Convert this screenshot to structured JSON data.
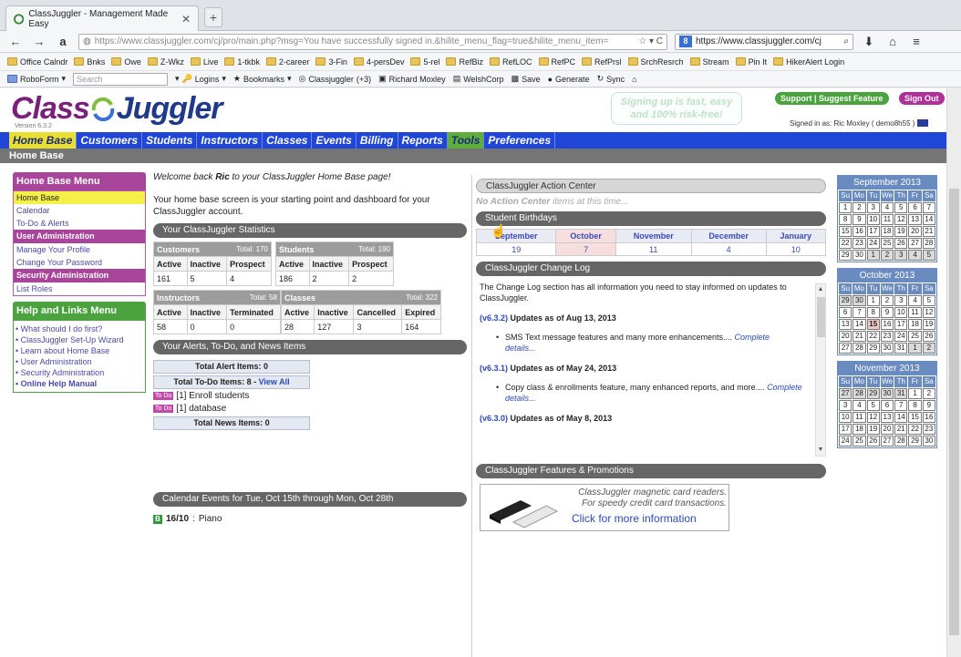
{
  "browser": {
    "tab_title": "ClassJuggler - Management Made Easy",
    "url": "https://www.classjuggler.com/cj/pro/main.php?msg=You have successfully signed in.&hilite_menu_flag=true&hilite_menu_item=",
    "search_text": "https://www.classjuggler.com/cj",
    "bookmarks": [
      "Office Calndr",
      "Bnks",
      "Owe",
      "Z-Wkz",
      "Live",
      "1-tkbk",
      "2-career",
      "3-Fin",
      "4-persDev",
      "5-rel",
      "RefBiz",
      "RefLOC",
      "RefPC",
      "RefPrsl",
      "SrchResrch",
      "Stream",
      "Pin It",
      "HikerAlert Login"
    ],
    "toolbar": {
      "roboform": "RoboForm",
      "search_placeholder": "Search",
      "logins": "Logins",
      "bookmarks": "Bookmarks",
      "classjuggler": "Classjuggler",
      "cj_count": "(+3)",
      "richard": "Richard Moxley",
      "welshcorp": "WelshCorp",
      "save": "Save",
      "generate": "Generate",
      "sync": "Sync"
    }
  },
  "header": {
    "logo_part1": "Class",
    "logo_part2": "Juggler",
    "version": "Version 6.3.2",
    "promo_line1": "Signing up is fast, easy",
    "promo_line2": "and 100% risk-free!",
    "support": "Support",
    "suggest": "Suggest Feature",
    "signout": "Sign Out",
    "signed_in": "Signed in as: Ric Moxley ( demo8h55 )"
  },
  "nav": [
    "Home Base",
    "Customers",
    "Students",
    "Instructors",
    "Classes",
    "Events",
    "Billing",
    "Reports",
    "Tools",
    "Preferences"
  ],
  "page_title": "Home Base",
  "left_menu": {
    "title": "Home Base Menu",
    "items": [
      "Home Base",
      "Calendar",
      "To-Do & Alerts"
    ],
    "user_admin_title": "User Administration",
    "user_admin_items": [
      "Manage Your Profile",
      "Change Your Password"
    ],
    "security_title": "Security Administration",
    "security_items": [
      "List Roles"
    ],
    "help_title": "Help and Links Menu",
    "help_items": [
      "What should I do first?",
      "ClassJuggler Set-Up Wizard",
      "Learn about Home Base",
      "User Administration",
      "Security Administration",
      "Online Help Manual"
    ]
  },
  "center": {
    "welcome_pre": "Welcome back ",
    "welcome_name": "Ric",
    "welcome_post": " to your ClassJuggler Home Base page!",
    "desc": "Your home base screen is your starting point and dashboard for your ClassJuggler account.",
    "stats_title": "Your ClassJuggler Statistics",
    "customers": {
      "title": "Customers",
      "total": "Total: 170",
      "labels": [
        "Active",
        "Inactive",
        "Prospect"
      ],
      "values": [
        "161",
        "5",
        "4"
      ]
    },
    "students": {
      "title": "Students",
      "total": "Total: 190",
      "labels": [
        "Active",
        "Inactive",
        "Prospect"
      ],
      "values": [
        "186",
        "2",
        "2"
      ]
    },
    "instructors": {
      "title": "Instructors",
      "total": "Total: 58",
      "labels": [
        "Active",
        "Inactive",
        "Terminated"
      ],
      "values": [
        "58",
        "0",
        "0"
      ]
    },
    "classes": {
      "title": "Classes",
      "total": "Total: 322",
      "labels": [
        "Active",
        "Inactive",
        "Cancelled",
        "Expired"
      ],
      "values": [
        "28",
        "127",
        "3",
        "164"
      ]
    },
    "alerts_title": "Your Alerts, To-Do, and News Items",
    "total_alert": "Total Alert Items: 0",
    "total_todo": "Total To-Do Items: 8",
    "view_all": "View All",
    "todo_tag": "To Do",
    "todos": [
      "[1] Enroll students",
      "[1] database"
    ],
    "total_news": "Total News Items: 0",
    "cal_title": "Calendar Events for Tue, Oct 15th through Mon, Oct 28th",
    "event_badge": "B",
    "event_date": "16/10",
    "event_name": "Piano"
  },
  "right": {
    "action_title": "ClassJuggler Action Center",
    "action_note_bold": "No Action Center",
    "action_note": " items at this time...",
    "birthdays_title": "Student Birthdays",
    "birthdays": {
      "months": [
        "September",
        "October",
        "November",
        "December",
        "January"
      ],
      "counts": [
        "19",
        "7",
        "11",
        "4",
        "10"
      ]
    },
    "changelog_title": "ClassJuggler Change Log",
    "changelog_intro": "The Change Log section has all information you need to stay informed on updates to ClassJuggler.",
    "entries": [
      {
        "ver": "(v6.3.2)",
        "date": "Updates as of Aug 13, 2013",
        "text": "SMS Text message features and many more enhancements....",
        "link": "Complete details..."
      },
      {
        "ver": "(v6.3.1)",
        "date": "Updates as of May 24, 2013",
        "text": "Copy class & enrollments feature, many enhanced reports, and more....",
        "link": "Complete details..."
      },
      {
        "ver": "(v6.3.0)",
        "date": "Updates as of May 8, 2013",
        "text": "",
        "link": ""
      }
    ],
    "features_title": "ClassJuggler Features & Promotions",
    "promo_line1": "ClassJuggler magnetic card readers.",
    "promo_line2": "For speedy credit card transactions.",
    "promo_link": "Click for more information"
  },
  "calendars": [
    {
      "title": "September 2013",
      "weeks": [
        [
          "1",
          "2",
          "3",
          "4",
          "5",
          "6",
          "7"
        ],
        [
          "8",
          "9",
          "10",
          "11",
          "12",
          "13",
          "14"
        ],
        [
          "15",
          "16",
          "17",
          "18",
          "19",
          "20",
          "21"
        ],
        [
          "22",
          "23",
          "24",
          "25",
          "26",
          "27",
          "28"
        ],
        [
          "29",
          "30",
          "1",
          "2",
          "3",
          "4",
          "5"
        ]
      ]
    },
    {
      "title": "October 2013",
      "weeks": [
        [
          "29",
          "30",
          "1",
          "2",
          "3",
          "4",
          "5"
        ],
        [
          "6",
          "7",
          "8",
          "9",
          "10",
          "11",
          "12"
        ],
        [
          "13",
          "14",
          "15",
          "16",
          "17",
          "18",
          "19"
        ],
        [
          "20",
          "21",
          "22",
          "23",
          "24",
          "25",
          "26"
        ],
        [
          "27",
          "28",
          "29",
          "30",
          "31",
          "1",
          "2"
        ]
      ]
    },
    {
      "title": "November 2013",
      "weeks": [
        [
          "27",
          "28",
          "29",
          "30",
          "31",
          "1",
          "2"
        ],
        [
          "3",
          "4",
          "5",
          "6",
          "7",
          "8",
          "9"
        ],
        [
          "10",
          "11",
          "12",
          "13",
          "14",
          "15",
          "16"
        ],
        [
          "17",
          "18",
          "19",
          "20",
          "21",
          "22",
          "23"
        ],
        [
          "24",
          "25",
          "26",
          "27",
          "28",
          "29",
          "30"
        ]
      ]
    }
  ],
  "day_headers": [
    "Su",
    "Mo",
    "Tu",
    "We",
    "Th",
    "Fr",
    "Sa"
  ],
  "colors": {
    "nav_blue": "#1f46d6",
    "brand_purple": "#a8449a",
    "help_green": "#4aa33e",
    "highlight_yellow": "#f4f047"
  }
}
